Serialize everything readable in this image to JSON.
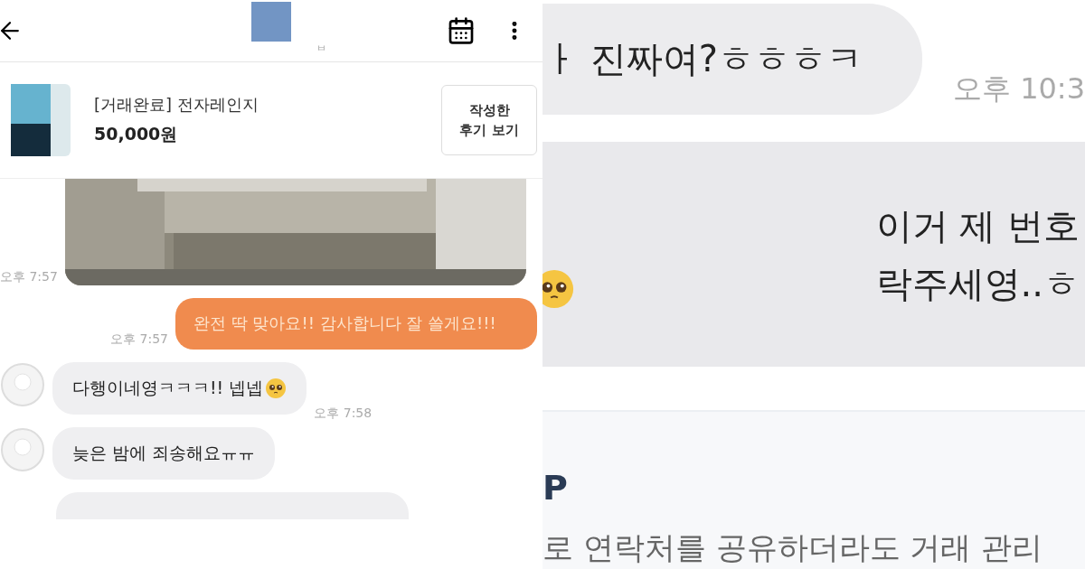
{
  "left": {
    "header": {
      "subtitle": "ㅂ"
    },
    "product": {
      "status": "[거래완료]",
      "name": "전자레인지",
      "price": "50,000원",
      "button": "작성한\n후기 보기"
    },
    "messages": [
      {
        "time": "오후 7:57"
      },
      {
        "kind": "sent",
        "text": "완전 딱 맞아요!! 감사합니다 잘 쓸게요!!!",
        "time": "오후 7:57"
      },
      {
        "kind": "received",
        "text": "다행이네영ㅋㅋㅋ!! 넵넵",
        "emoji": true,
        "time": "오후 7:58"
      },
      {
        "kind": "received",
        "text": "늦은 밤에 죄송해요ㅠㅠ"
      },
      {
        "kind": "partial"
      }
    ]
  },
  "right": {
    "messages": [
      {
        "kind": "received",
        "text": "ㅏ 진짜여?ㅎㅎㅎㅋ",
        "time": "오후 10:3"
      },
      {
        "kind": "band",
        "lines": [
          "이거 제 번호",
          "락주세영..ㅎ"
        ],
        "emoji": true
      }
    ],
    "notice": {
      "heading": "P",
      "text": "로 연락처를 공유하더라도 거래 관리"
    }
  }
}
